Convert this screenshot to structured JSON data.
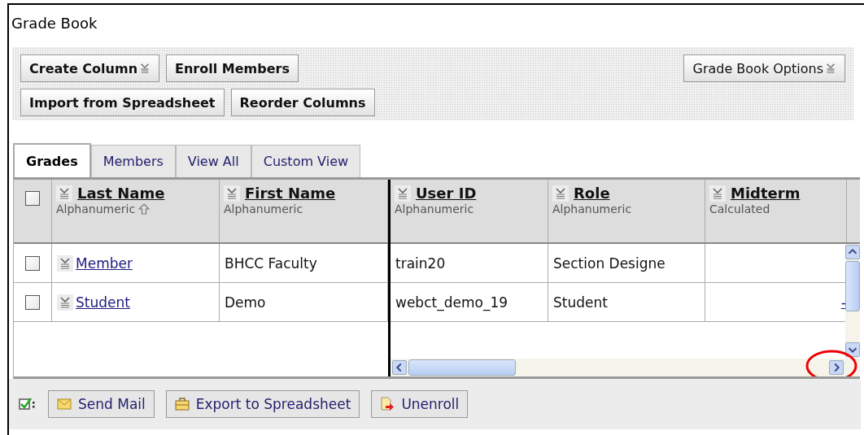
{
  "window": {
    "title": "Grade Book"
  },
  "toolbar": {
    "rows": [
      [
        {
          "label": "Create Column",
          "menu": true
        },
        {
          "label": "Enroll Members",
          "menu": false
        }
      ],
      [
        {
          "label": "Import from Spreadsheet",
          "menu": false
        },
        {
          "label": "Reorder Columns",
          "menu": false
        }
      ]
    ],
    "options_button": {
      "label": "Grade Book Options",
      "menu": true
    }
  },
  "tabs": [
    {
      "label": "Grades",
      "selected": true
    },
    {
      "label": "Members",
      "selected": false
    },
    {
      "label": "View All",
      "selected": false
    },
    {
      "label": "Custom View",
      "selected": false
    }
  ],
  "table": {
    "select_all_checked": false,
    "frozen_columns": [
      {
        "name": "Last Name",
        "type": "Alphanumeric",
        "sorted": true,
        "kind": "link"
      },
      {
        "name": "First Name",
        "type": "Alphanumeric",
        "sorted": false,
        "kind": "text"
      }
    ],
    "scrolling_columns": [
      {
        "name": "User ID",
        "type": "Alphanumeric",
        "sorted": false,
        "kind": "text"
      },
      {
        "name": "Role",
        "type": "Alphanumeric",
        "sorted": false,
        "kind": "text"
      },
      {
        "name": "Midterm",
        "type": "Calculated",
        "sorted": false,
        "kind": "grade"
      }
    ],
    "rows": [
      {
        "checked": false,
        "frozen_cells": [
          "Member",
          "BHCC Faculty"
        ],
        "scrolling_cells": [
          "train20",
          "Section Designe"
        ]
      },
      {
        "checked": false,
        "frozen_cells": [
          "Student",
          "Demo"
        ],
        "scrolling_cells": [
          "webct_demo_19",
          "Student",
          "-"
        ]
      }
    ]
  },
  "footer": {
    "actions": [
      {
        "kind": "mail",
        "label": "Send Mail"
      },
      {
        "kind": "export",
        "label": "Export to Spreadsheet"
      },
      {
        "kind": "unenroll",
        "label": "Unenroll"
      }
    ]
  }
}
